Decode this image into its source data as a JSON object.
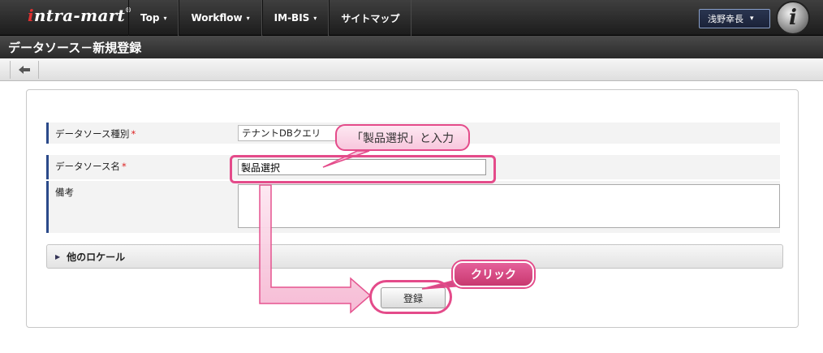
{
  "header": {
    "logo": "intra-mart",
    "nav": [
      {
        "label": "Top",
        "caret": "▾"
      },
      {
        "label": "Workflow",
        "caret": "▾"
      },
      {
        "label": "IM-BIS",
        "caret": "▾"
      },
      {
        "label": "サイトマップ",
        "caret": ""
      }
    ],
    "user": "浅野幸長",
    "user_caret": "▾"
  },
  "page": {
    "title": "データソース－新規登録",
    "back_icon": "arrow-left-icon"
  },
  "form": {
    "type_label": "データソース種別",
    "type_required": "*",
    "type_value": "テナントDBクエリ",
    "name_label": "データソース名",
    "name_required": "*",
    "name_value": "製品選択",
    "note_label": "備考",
    "note_value": "",
    "locale_label": "他のロケール",
    "submit_label": "登録"
  },
  "annotations": {
    "input_callout": "「製品選択」と入力",
    "click_callout": "クリック",
    "accent_color": "#e44b8a"
  }
}
